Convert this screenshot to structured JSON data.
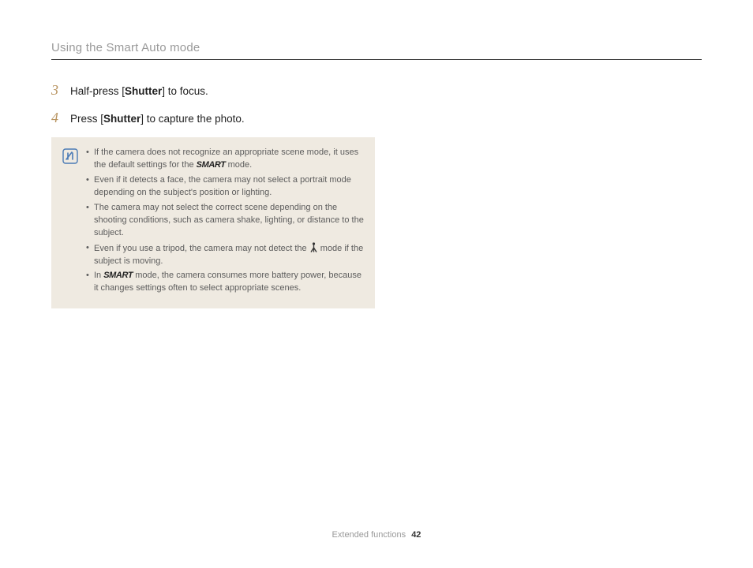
{
  "header": {
    "section_title": "Using the Smart Auto mode"
  },
  "steps": [
    {
      "num": "3",
      "pre": "Half-press [",
      "bold": "Shutter",
      "post": "] to focus."
    },
    {
      "num": "4",
      "pre": "Press [",
      "bold": "Shutter",
      "post": "] to capture the photo."
    }
  ],
  "notes": {
    "smart_label": "SMART",
    "item1_pre": "If the camera does not recognize an appropriate scene mode, it uses the default settings for the ",
    "item1_post": " mode.",
    "item2": "Even if it detects a face, the camera may not select a portrait mode depending on the subject's position or lighting.",
    "item3": "The camera may not select the correct scene depending on the shooting conditions, such as camera shake, lighting, or distance to the subject.",
    "item4_pre": "Even if you use a tripod, the camera may not detect the ",
    "item4_post": " mode if the subject is moving.",
    "item5_pre": "In ",
    "item5_post": " mode, the camera consumes more battery power, because it changes settings often to select appropriate scenes."
  },
  "footer": {
    "label": "Extended functions",
    "page": "42"
  }
}
